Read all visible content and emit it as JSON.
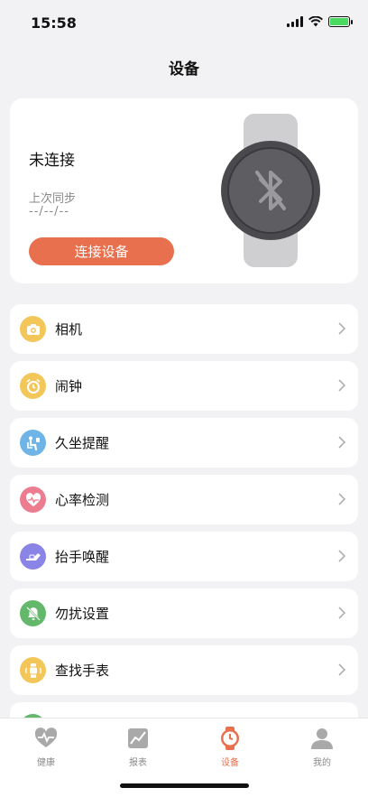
{
  "status_bar": {
    "time": "15:58"
  },
  "header": {
    "title": "设备"
  },
  "device_card": {
    "connection_status": "未连接",
    "last_sync_label": "上次同步",
    "last_sync_value": "--/--/--",
    "connect_button": "连接设备"
  },
  "menu": [
    {
      "label": "相机",
      "icon": "camera-icon",
      "color": "#f2c659"
    },
    {
      "label": "闹钟",
      "icon": "alarm-clock-icon",
      "color": "#f2c659"
    },
    {
      "label": "久坐提醒",
      "icon": "sedentary-icon",
      "color": "#6fb4e6"
    },
    {
      "label": "心率检测",
      "icon": "heart-rate-icon",
      "color": "#ec7c8f"
    },
    {
      "label": "抬手唤醒",
      "icon": "raise-hand-icon",
      "color": "#8a84e6"
    },
    {
      "label": "勿扰设置",
      "icon": "do-not-disturb-icon",
      "color": "#63b86b"
    },
    {
      "label": "查找手表",
      "icon": "find-watch-icon",
      "color": "#f2c659"
    }
  ],
  "tabs": [
    {
      "label": "健康",
      "icon": "heart-pulse-icon",
      "active": false
    },
    {
      "label": "报表",
      "icon": "chart-icon",
      "active": false
    },
    {
      "label": "设备",
      "icon": "watch-icon",
      "active": true
    },
    {
      "label": "我的",
      "icon": "profile-icon",
      "active": false
    }
  ],
  "colors": {
    "accent": "#e8704f",
    "background": "#f2f2f4"
  }
}
